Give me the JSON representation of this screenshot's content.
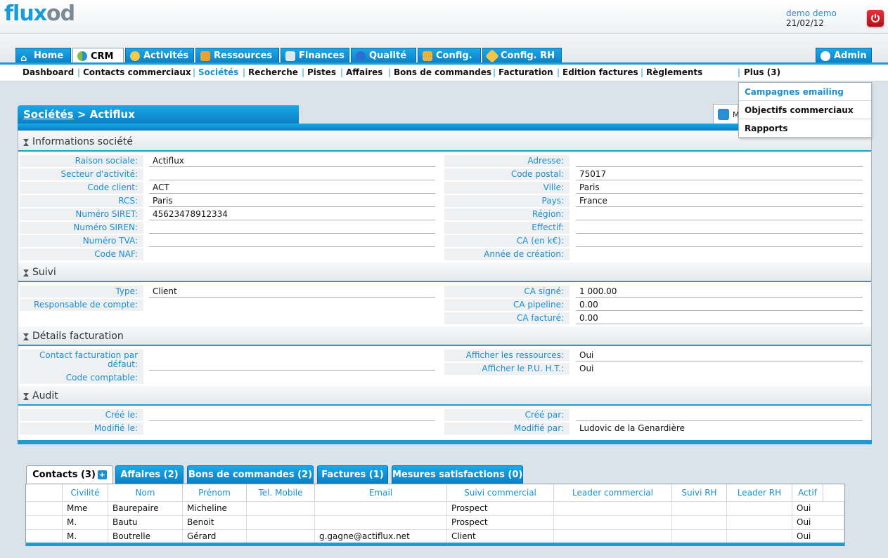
{
  "header": {
    "logo_part1": "flux",
    "logo_part2": "od",
    "user": "demo demo",
    "date": "21/02/12"
  },
  "main_tabs": [
    {
      "label": "Home",
      "icon": "home-icon"
    },
    {
      "label": "CRM",
      "icon": "crm-icon"
    },
    {
      "label": "Activités",
      "icon": "clock-icon"
    },
    {
      "label": "Ressources",
      "icon": "people-icon"
    },
    {
      "label": "Finances",
      "icon": "chart-icon"
    },
    {
      "label": "Qualité",
      "icon": "info-icon"
    },
    {
      "label": "Config.",
      "icon": "tools-icon"
    },
    {
      "label": "Config. RH",
      "icon": "gear-icon"
    },
    {
      "label": "Admin",
      "icon": "cog-icon"
    }
  ],
  "sub_nav": [
    "Dashboard",
    "Contacts commerciaux",
    "Sociétés",
    "Recherche",
    "Pistes",
    "Affaires",
    "Bons de commandes",
    "Facturation",
    "Edition factures",
    "Règlements"
  ],
  "plus_menu": {
    "label": "Plus (3)",
    "items": [
      "Campagnes emailing",
      "Objectifs commerciaux",
      "Rapports"
    ]
  },
  "panel": {
    "title_link": "Sociétés",
    "title_rest": " > Actiflux",
    "edit_label": "M"
  },
  "sections": {
    "info": "Informations société",
    "suivi": "Suivi",
    "facturation": "Détails facturation",
    "audit": "Audit"
  },
  "info_left": [
    {
      "label": "Raison sociale:",
      "value": "Actiflux"
    },
    {
      "label": "Secteur d'activité:",
      "value": ""
    },
    {
      "label": "Code client:",
      "value": "ACT"
    },
    {
      "label": "RCS:",
      "value": "Paris"
    },
    {
      "label": "Numéro SIRET:",
      "value": "45623478912334"
    },
    {
      "label": "Numéro SIREN:",
      "value": ""
    },
    {
      "label": "Numéro TVA:",
      "value": ""
    },
    {
      "label": "Code NAF:",
      "value": ""
    }
  ],
  "info_right": [
    {
      "label": "Adresse:",
      "value": ""
    },
    {
      "label": "Code postal:",
      "value": "75017"
    },
    {
      "label": "Ville:",
      "value": "Paris"
    },
    {
      "label": "Pays:",
      "value": "France"
    },
    {
      "label": "Région:",
      "value": ""
    },
    {
      "label": "Effectif:",
      "value": ""
    },
    {
      "label": "CA (en k€):",
      "value": ""
    },
    {
      "label": "Année de création:",
      "value": ""
    }
  ],
  "suivi_left": [
    {
      "label": "Type:",
      "value": "Client"
    },
    {
      "label": "Responsable de compte:",
      "value": ""
    }
  ],
  "suivi_right": [
    {
      "label": "CA signé:",
      "value": "1 000.00"
    },
    {
      "label": "CA pipeline:",
      "value": "0.00"
    },
    {
      "label": "CA facturé:",
      "value": "0.00"
    }
  ],
  "fact_left": [
    {
      "label": "Contact facturation par",
      "label2": "défaut:",
      "value": ""
    },
    {
      "label": "Code comptable:",
      "value": ""
    }
  ],
  "fact_right": [
    {
      "label": "Afficher les ressources:",
      "value": "Oui"
    },
    {
      "label": "Afficher le P.U. H.T.:",
      "value": "Oui"
    }
  ],
  "audit_left": [
    {
      "label": "Créé le:",
      "value": ""
    },
    {
      "label": "Modifié le:",
      "value": ""
    }
  ],
  "audit_right": [
    {
      "label": "Créé par:",
      "value": ""
    },
    {
      "label": "Modifié par:",
      "value": "Ludovic de la Genardière"
    }
  ],
  "bottom_tabs": [
    "Contacts (3)",
    "Affaires (2)",
    "Bons de commandes (2)",
    "Factures (1)",
    "Mesures satisfactions (0)"
  ],
  "contacts": {
    "columns": [
      "Civilité",
      "Nom",
      "Prénom",
      "Tel. Mobile",
      "Email",
      "Suivi commercial",
      "Leader commercial",
      "Suivi RH",
      "Leader RH",
      "Actif"
    ],
    "rows": [
      [
        "Mme",
        "Baurepaire",
        "Micheline",
        "",
        "",
        "Prospect",
        "",
        "",
        "",
        "Oui"
      ],
      [
        "M.",
        "Bautu",
        "Benoit",
        "",
        "",
        "Prospect",
        "",
        "",
        "",
        "Oui"
      ],
      [
        "M.",
        "Boutrelle",
        "Gérard",
        "",
        "g.gagne@actiflux.net",
        "Client",
        "",
        "",
        "",
        "Oui"
      ]
    ]
  },
  "colors": {
    "accent": "#1a9bd7",
    "label": "#1a8fd0",
    "danger": "#d7262e"
  }
}
